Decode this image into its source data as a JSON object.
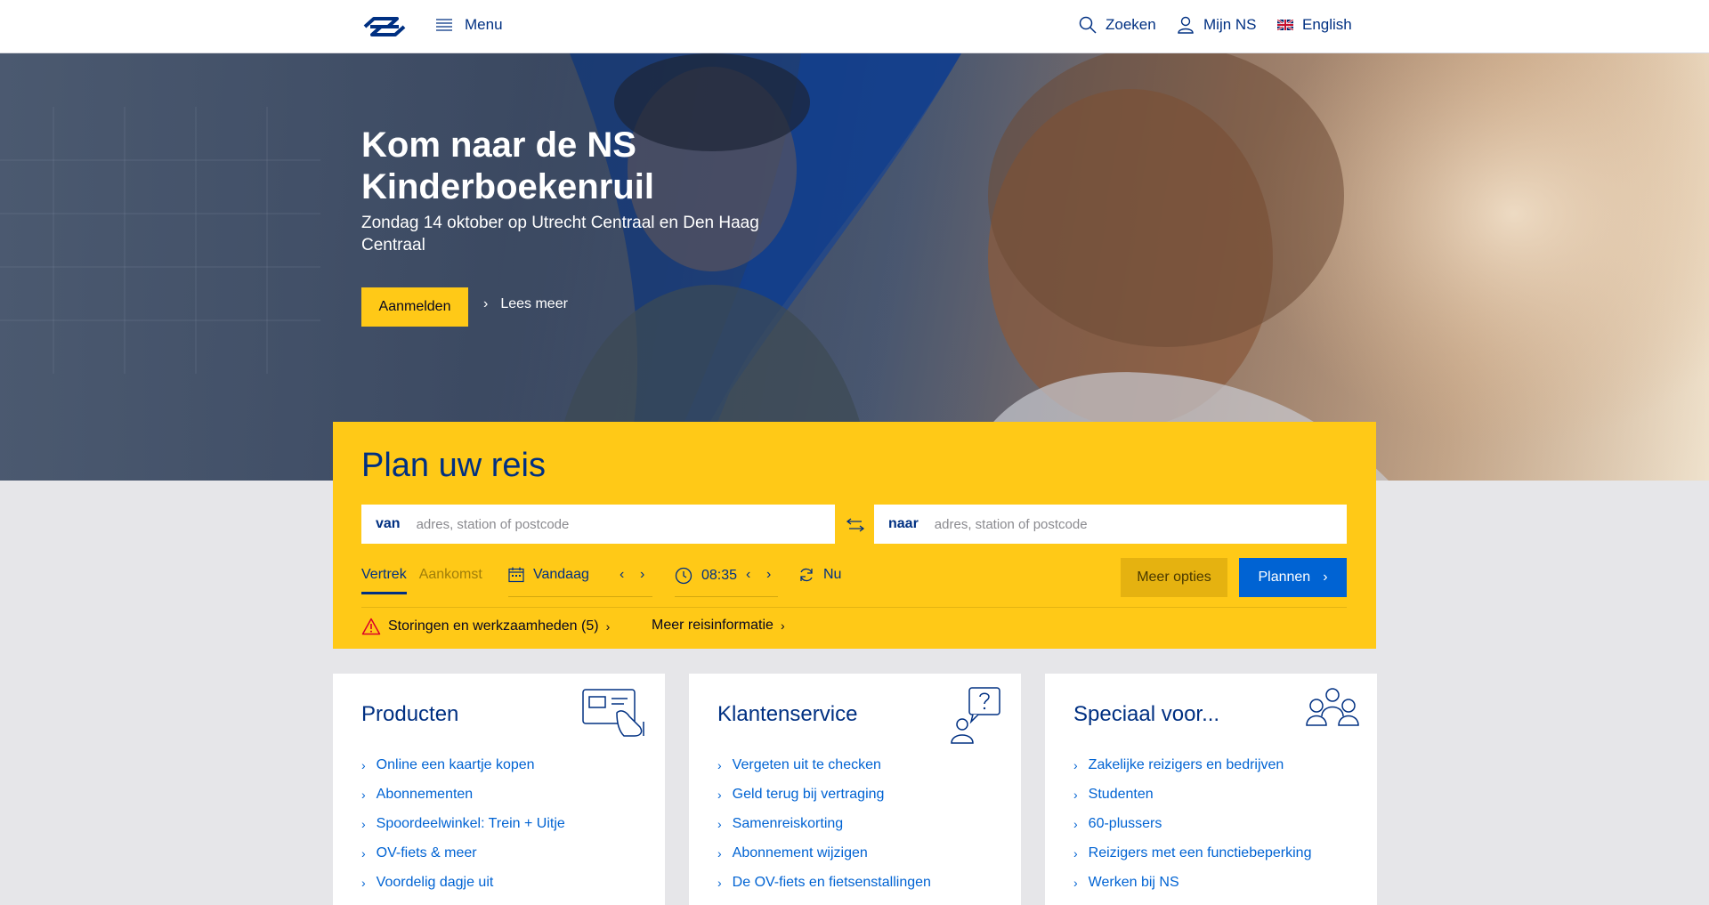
{
  "header": {
    "menu_label": "Menu",
    "search_label": "Zoeken",
    "account_label": "Mijn NS",
    "language_label": "English"
  },
  "hero": {
    "title": "Kom naar de NS Kinderboekenruil",
    "subtitle": "Zondag 14 oktober op Utrecht Centraal en Den Haag Centraal",
    "cta_label": "Aanmelden",
    "read_more_label": "Lees meer"
  },
  "planner": {
    "title": "Plan uw reis",
    "from_label": "van",
    "from_placeholder": "adres, station of postcode",
    "to_label": "naar",
    "to_placeholder": "adres, station of postcode",
    "tabs": [
      {
        "label": "Vertrek",
        "active": true
      },
      {
        "label": "Aankomst",
        "active": false
      }
    ],
    "date_label": "Vandaag",
    "time_label": "08:35",
    "now_label": "Nu",
    "more_options_label": "Meer opties",
    "plan_label": "Plannen",
    "disruptions_label": "Storingen en werkzaamheden (5)",
    "more_info_label": "Meer reisinformatie"
  },
  "cards": [
    {
      "title": "Producten",
      "icon": "ticket-card-icon",
      "links": [
        "Online een kaartje kopen",
        "Abonnementen",
        "Spoordeelwinkel: Trein + Uitje",
        "OV-fiets & meer",
        "Voordelig dagje uit"
      ]
    },
    {
      "title": "Klantenservice",
      "icon": "person-question-icon",
      "links": [
        "Vergeten uit te checken",
        "Geld terug bij vertraging",
        "Samenreiskorting",
        "Abonnement wijzigen",
        "De OV-fiets en fietsenstallingen"
      ]
    },
    {
      "title": "Speciaal voor...",
      "icon": "group-icon",
      "links": [
        "Zakelijke reizigers en bedrijven",
        "Studenten",
        "60-plussers",
        "Reizigers met een functiebeperking",
        "Werken bij NS"
      ]
    }
  ],
  "colors": {
    "ns_blue": "#003082",
    "ns_yellow": "#ffc917",
    "link_blue": "#0063d3",
    "warning_red": "#db0029"
  }
}
